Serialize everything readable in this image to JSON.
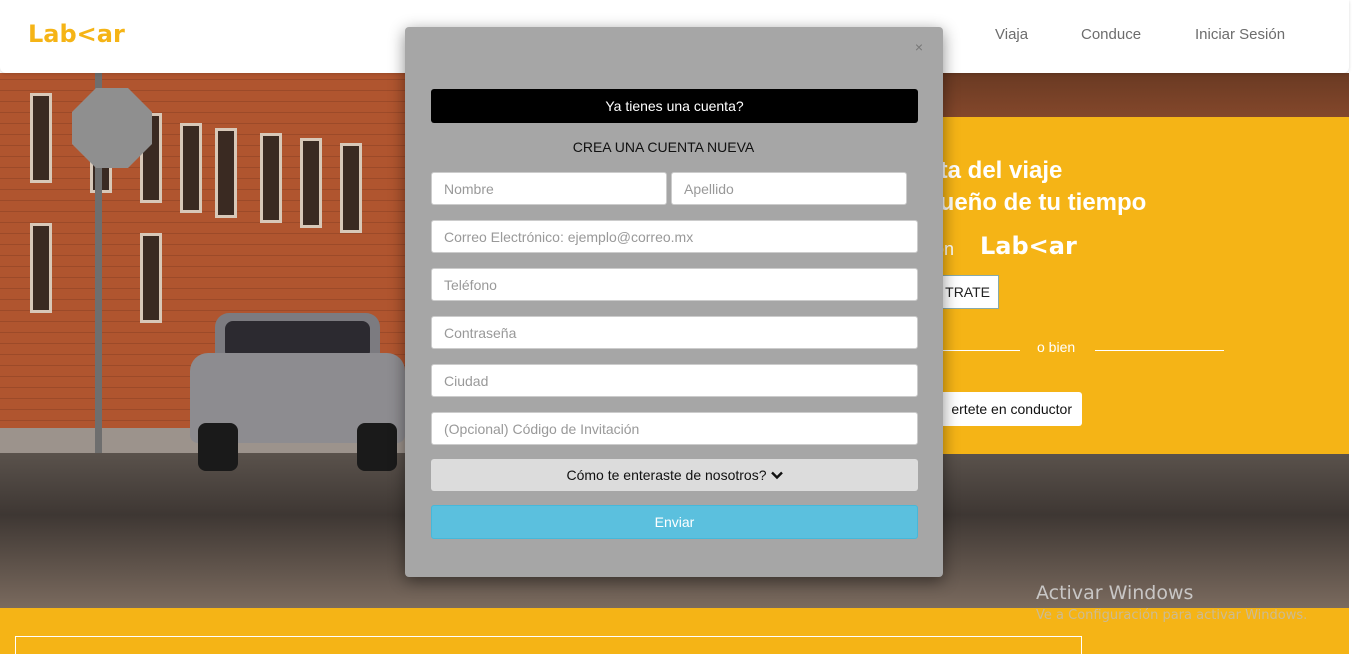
{
  "navbar": {
    "logo_pre": "Lab",
    "logo_chev": "<",
    "logo_post": "ar",
    "links": [
      "Viaja",
      "Conduce",
      "Iniciar Sesión"
    ]
  },
  "promo": {
    "line1": "uta del viaje",
    "line2": "dueño de tu tiempo",
    "con": "con",
    "logo": "Lab<ar",
    "register_button": "TRATE",
    "or_text": "o bien",
    "driver_button": "ertete en conductor"
  },
  "modal": {
    "close": "×",
    "have_account_button": "Ya tienes una cuenta?",
    "heading": "CREA UNA CUENTA NUEVA",
    "placeholders": {
      "nombre": "Nombre",
      "apellido": "Apellido",
      "correo": "Correo Electrónico: ejemplo@correo.mx",
      "telefono": "Teléfono",
      "contrasena": "Contraseña",
      "ciudad": "Ciudad",
      "codigo": "(Opcional) Código de Invitación"
    },
    "dropdown_label": "Cómo te enteraste de nosotros?",
    "submit_button": "Enviar"
  },
  "watermark": {
    "title": "Activar Windows",
    "subtitle": "Ve a Configuración para activar Windows."
  },
  "colors": {
    "brand": "#f5b416",
    "modal_bg": "#a6a6a6",
    "submit": "#5bc0de"
  }
}
